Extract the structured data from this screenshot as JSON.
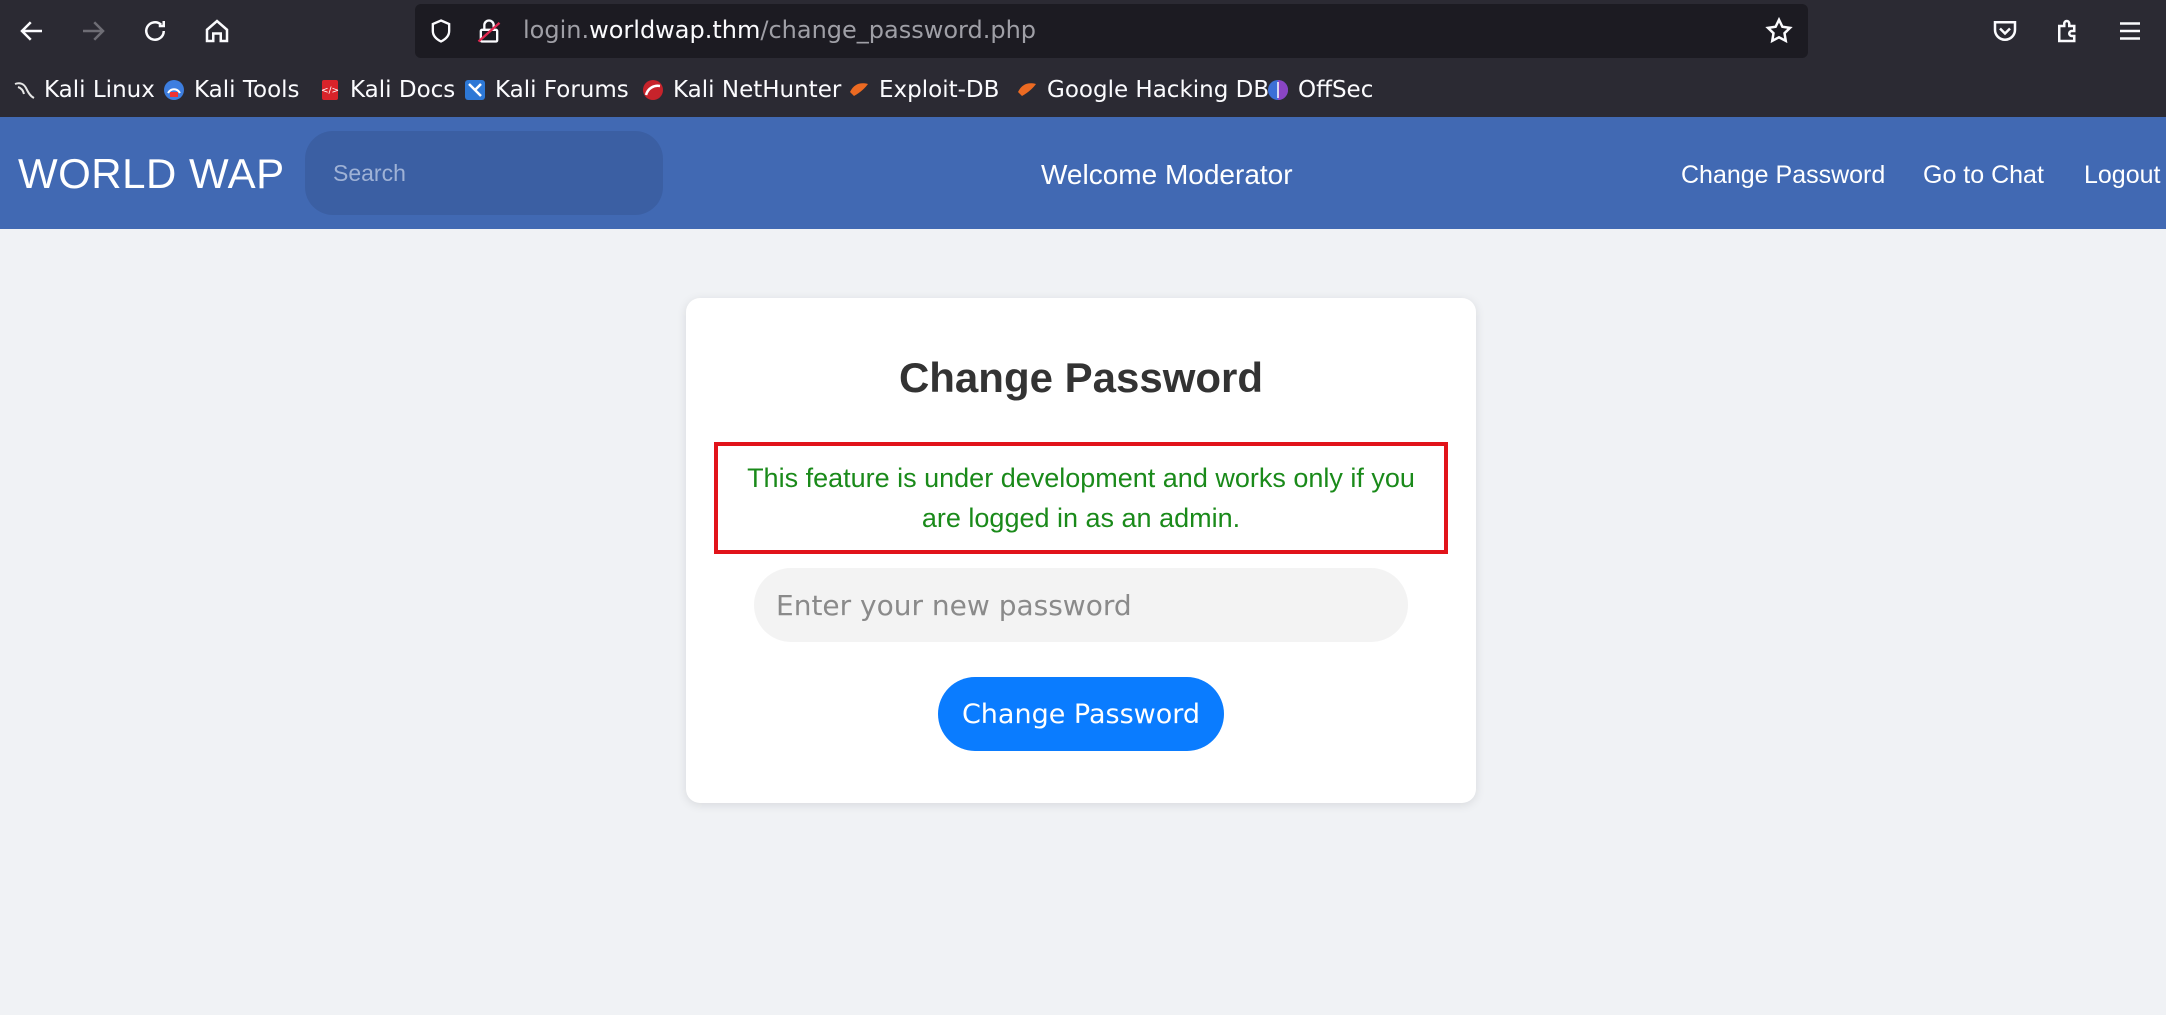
{
  "browser": {
    "url_prefix": "login.",
    "url_host": "worldwap.thm",
    "url_path": "/change_password.php",
    "bookmarks": [
      {
        "label": "Kali Linux",
        "icon": "kali-dragon-icon"
      },
      {
        "label": "Kali Tools",
        "icon": "kali-tools-icon"
      },
      {
        "label": "Kali Docs",
        "icon": "kali-docs-icon"
      },
      {
        "label": "Kali Forums",
        "icon": "kali-forums-icon"
      },
      {
        "label": "Kali NetHunter",
        "icon": "nethunter-icon"
      },
      {
        "label": "Exploit-DB",
        "icon": "exploit-db-icon"
      },
      {
        "label": "Google Hacking DB",
        "icon": "ghdb-icon"
      },
      {
        "label": "OffSec",
        "icon": "offsec-icon"
      }
    ]
  },
  "header": {
    "logo": "WORLD WAP",
    "search_placeholder": "Search",
    "welcome": "Welcome Moderator",
    "links": [
      "Change Password",
      "Go to Chat",
      "Logout"
    ]
  },
  "card": {
    "title": "Change Password",
    "notice": "This feature is under development and works only if you are logged in as an admin.",
    "input_placeholder": "Enter your new password",
    "button_label": "Change Password"
  },
  "colors": {
    "header_bg": "#4169b3",
    "notice_border": "#e1131a",
    "notice_text": "#1a8a1a",
    "button_bg": "#0a7cff"
  }
}
